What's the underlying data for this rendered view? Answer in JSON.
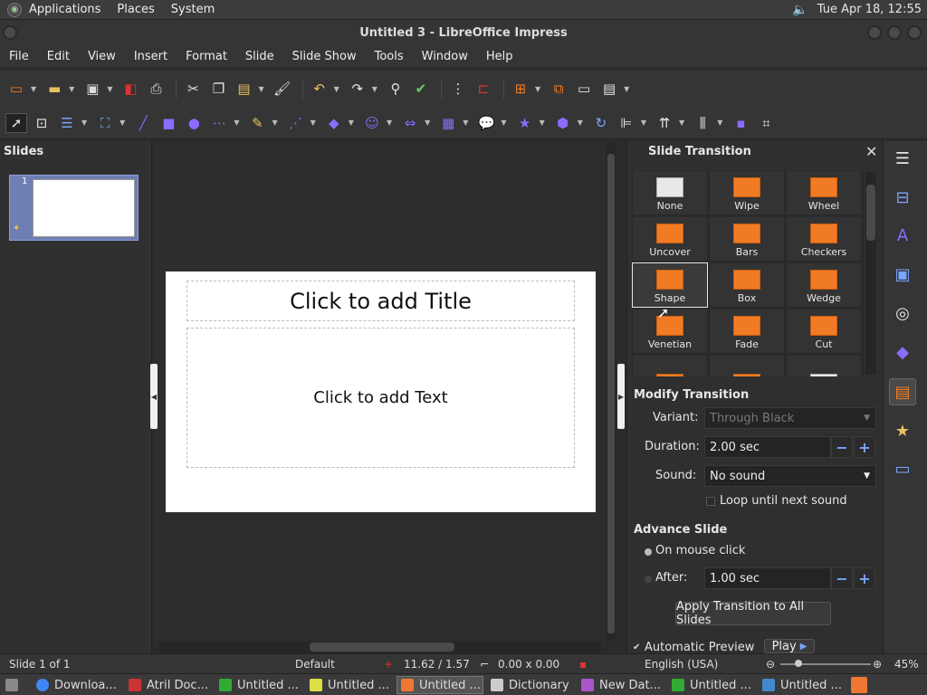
{
  "top_panel": {
    "menus": [
      "Applications",
      "Places",
      "System"
    ],
    "clock": "Tue Apr 18, 12:55"
  },
  "window": {
    "title": "Untitled 3 - LibreOffice Impress"
  },
  "menubar": [
    "File",
    "Edit",
    "View",
    "Insert",
    "Format",
    "Slide",
    "Slide Show",
    "Tools",
    "Window",
    "Help"
  ],
  "slides_pane": {
    "title": "Slides",
    "slide_number": "1"
  },
  "slide": {
    "title_placeholder": "Click to add Title",
    "text_placeholder": "Click to add Text"
  },
  "transition_panel": {
    "title": "Slide Transition",
    "transitions": [
      "None",
      "Wipe",
      "Wheel",
      "Uncover",
      "Bars",
      "Checkers",
      "Shape",
      "Box",
      "Wedge",
      "Venetian",
      "Fade",
      "Cut"
    ],
    "selected": "Shape",
    "modify_title": "Modify Transition",
    "variant_label": "Variant:",
    "variant_value": "Through Black",
    "duration_label": "Duration:",
    "duration_value": "2.00 sec",
    "sound_label": "Sound:",
    "sound_value": "No sound",
    "loop_label": "Loop until next sound",
    "advance_title": "Advance Slide",
    "on_click_label": "On mouse click",
    "after_label": "After:",
    "after_value": "1.00 sec",
    "apply_all_label": "Apply Transition to All Slides",
    "auto_preview_label": "Automatic Preview",
    "play_label": "Play"
  },
  "statusbar": {
    "slide_info": "Slide 1 of 1",
    "master": "Default",
    "position": "11.62 / 1.57",
    "size": "0.00 x 0.00",
    "language": "English (USA)",
    "zoom": "45%"
  },
  "taskbar": [
    {
      "label": "Downloa...",
      "color": "#4285f4"
    },
    {
      "label": "Atril Doc...",
      "color": "#c33"
    },
    {
      "label": "Untitled ...",
      "color": "#3a3"
    },
    {
      "label": "Untitled ...",
      "color": "#dd4"
    },
    {
      "label": "Untitled ...",
      "color": "#e73",
      "active": true
    },
    {
      "label": "Dictionary",
      "color": "#ccc"
    },
    {
      "label": "New Dat...",
      "color": "#a5c"
    },
    {
      "label": "Untitled ...",
      "color": "#3a3"
    },
    {
      "label": "Untitled ...",
      "color": "#48c"
    }
  ],
  "colors": {
    "accent_orange": "#f07b24",
    "selection_blue": "#6d7fb4"
  }
}
